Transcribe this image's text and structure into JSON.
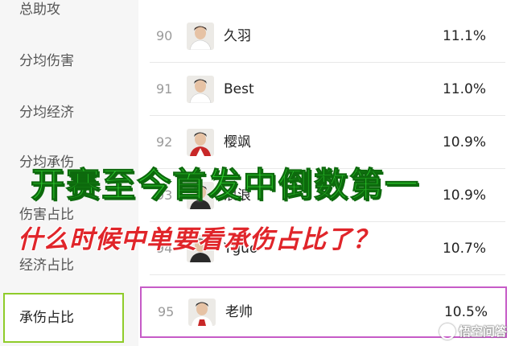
{
  "sidebar": {
    "items": [
      {
        "label": "总助攻"
      },
      {
        "label": "分均伤害"
      },
      {
        "label": "分均经济"
      },
      {
        "label": "分均承伤"
      },
      {
        "label": "伤害占比"
      },
      {
        "label": "经济占比"
      },
      {
        "label": "承伤占比",
        "active": true
      }
    ]
  },
  "rankings": [
    {
      "rank": "90",
      "name": "久羽",
      "value": "11.1%",
      "jersey_color": "#ffffff"
    },
    {
      "rank": "91",
      "name": "Best",
      "value": "11.0%",
      "jersey_color": "#ffffff"
    },
    {
      "rank": "92",
      "name": "樱飒",
      "value": "10.9%",
      "jersey_color": "#c82828"
    },
    {
      "rank": "93",
      "name": "浪浪",
      "value": "10.9%",
      "jersey_color": "#2a2a2a"
    },
    {
      "rank": "94",
      "name": "Yguo",
      "value": "10.7%",
      "jersey_color": "#2a2a2a"
    },
    {
      "rank": "95",
      "name": "老帅",
      "value": "10.5%",
      "jersey_color": "#c82828",
      "highlighted": true
    }
  ],
  "overlay": {
    "headline": "开赛至今首发中倒数第一",
    "subline": "什么时候中单要看承伤占比了？"
  },
  "watermark": {
    "text": "悟空问答",
    "icon": "wukong-logo-icon"
  },
  "colors": {
    "sidebar_bg": "#f6f6f6",
    "active_border": "#8fcc2a",
    "highlight_border": "#c65bc7",
    "headline": "#2fd12f",
    "subline": "#e0252a"
  }
}
